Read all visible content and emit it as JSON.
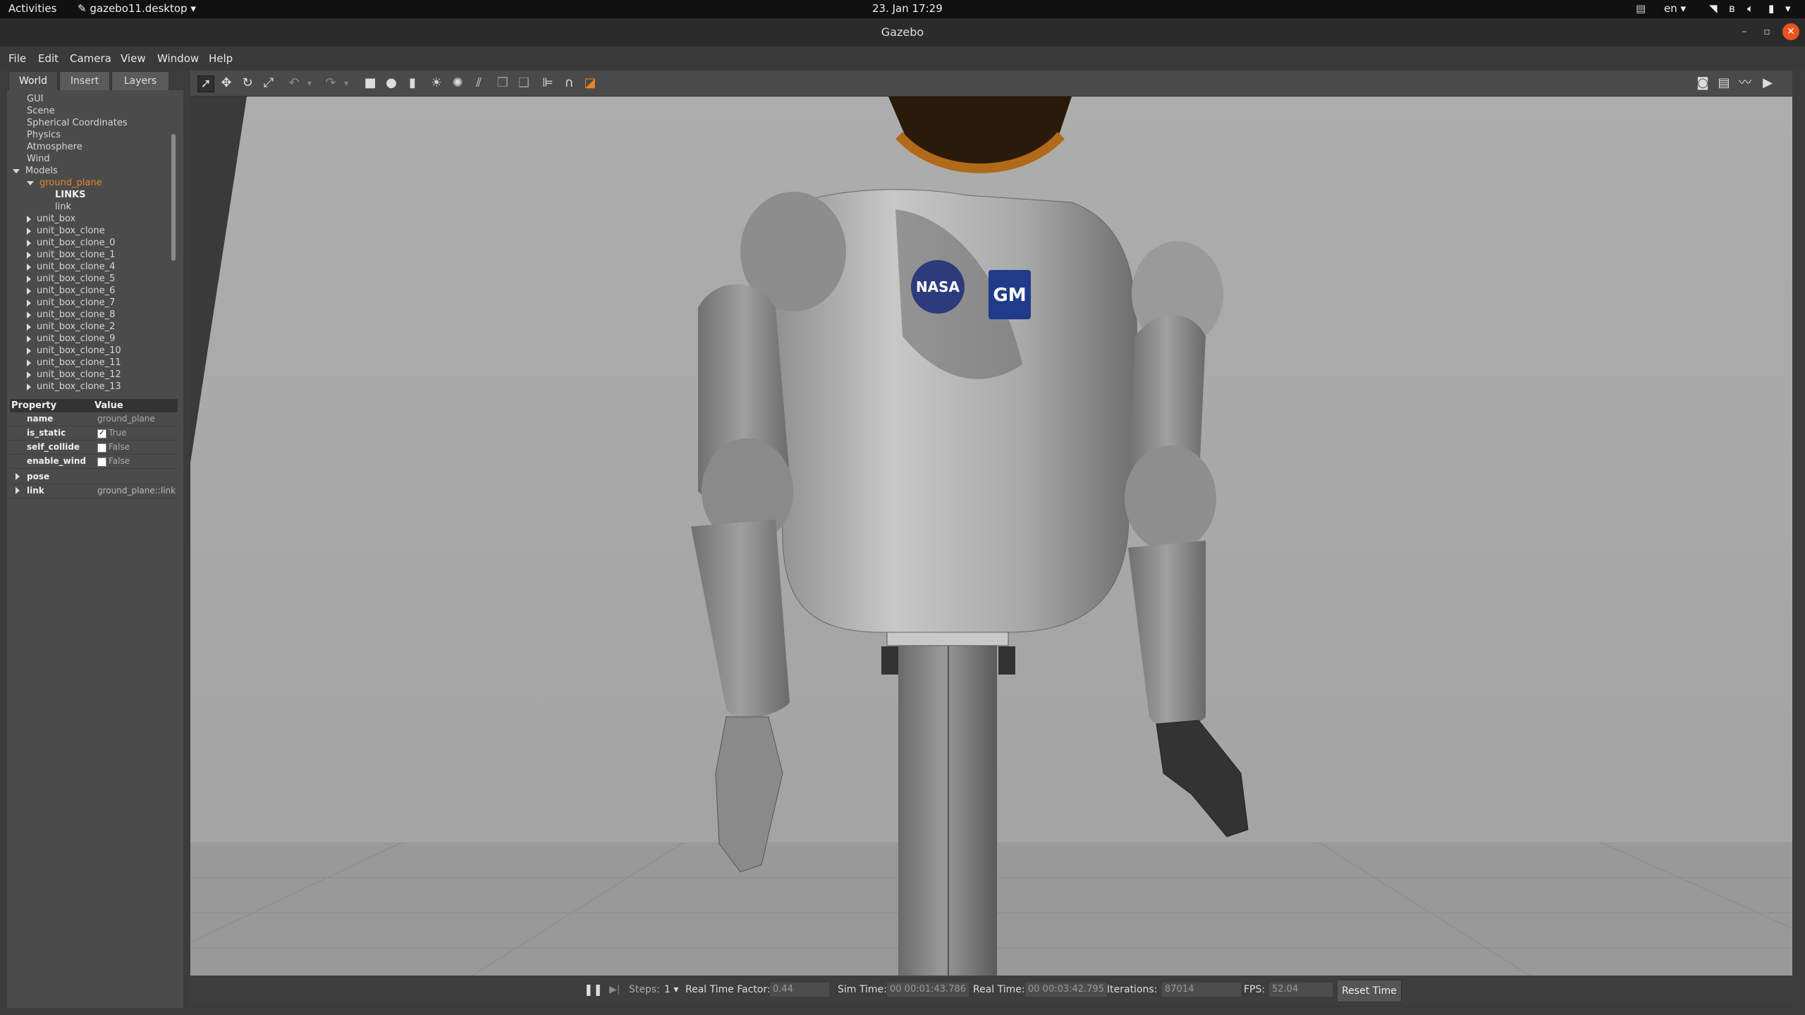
{
  "topbar": {
    "activities": "Activities",
    "app_menu": "gazebo11.desktop",
    "datetime": "23. Jan  17:29",
    "lang": "en"
  },
  "window": {
    "title": "Gazebo"
  },
  "menu": [
    "File",
    "Edit",
    "Camera",
    "View",
    "Window",
    "Help"
  ],
  "tabs": [
    "World",
    "Insert",
    "Layers"
  ],
  "tree": {
    "top_items": [
      "GUI",
      "Scene",
      "Spherical Coordinates",
      "Physics",
      "Atmosphere",
      "Wind"
    ],
    "models_label": "Models",
    "selected_model": "ground_plane",
    "links_label": "LINKS",
    "link_item": "link",
    "models": [
      "unit_box",
      "unit_box_clone",
      "unit_box_clone_0",
      "unit_box_clone_1",
      "unit_box_clone_4",
      "unit_box_clone_5",
      "unit_box_clone_6",
      "unit_box_clone_7",
      "unit_box_clone_8",
      "unit_box_clone_2",
      "unit_box_clone_9",
      "unit_box_clone_10",
      "unit_box_clone_11",
      "unit_box_clone_12",
      "unit_box_clone_13"
    ]
  },
  "properties": {
    "header_property": "Property",
    "header_value": "Value",
    "rows": [
      {
        "name": "name",
        "value": "ground_plane"
      },
      {
        "name": "is_static",
        "value": "True",
        "checked": true
      },
      {
        "name": "self_collide",
        "value": "False",
        "checked": false
      },
      {
        "name": "enable_wind",
        "value": "False",
        "checked": false
      },
      {
        "name": "pose",
        "value": ""
      },
      {
        "name": "link",
        "value": "ground_plane::link"
      }
    ]
  },
  "scene": {
    "logo_nasa": "NASA",
    "logo_gm": "GM"
  },
  "status": {
    "steps_label": "Steps:",
    "steps_value": "1",
    "rtf_label": "Real Time Factor:",
    "rtf_value": "0.44",
    "sim_time_label": "Sim Time:",
    "sim_time_value": "00 00:01:43.786",
    "real_time_label": "Real Time:",
    "real_time_value": "00 00:03:42.795",
    "iterations_label": "Iterations:",
    "iterations_value": "87014",
    "fps_label": "FPS:",
    "fps_value": "52.04",
    "reset_label": "Reset Time"
  }
}
